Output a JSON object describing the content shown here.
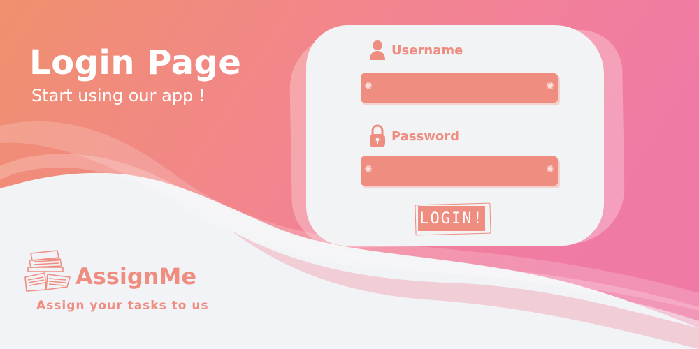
{
  "hero": {
    "title": "Login Page",
    "subtitle": "Start using our app !"
  },
  "form": {
    "username": {
      "label": "Username",
      "value": "",
      "placeholder": "",
      "icon": "user-icon"
    },
    "password": {
      "label": "Password",
      "value": "",
      "placeholder": "",
      "icon": "lock-icon"
    },
    "submit_label": "LOGIN!"
  },
  "brand": {
    "name": "AssignMe",
    "tagline": "Assign your tasks to us",
    "logo_icon": "books-icon"
  },
  "colors": {
    "accent": "#ef8d80",
    "gradient_start": "#f09070",
    "gradient_end": "#f07aa6",
    "background": "#f2f3f5"
  }
}
